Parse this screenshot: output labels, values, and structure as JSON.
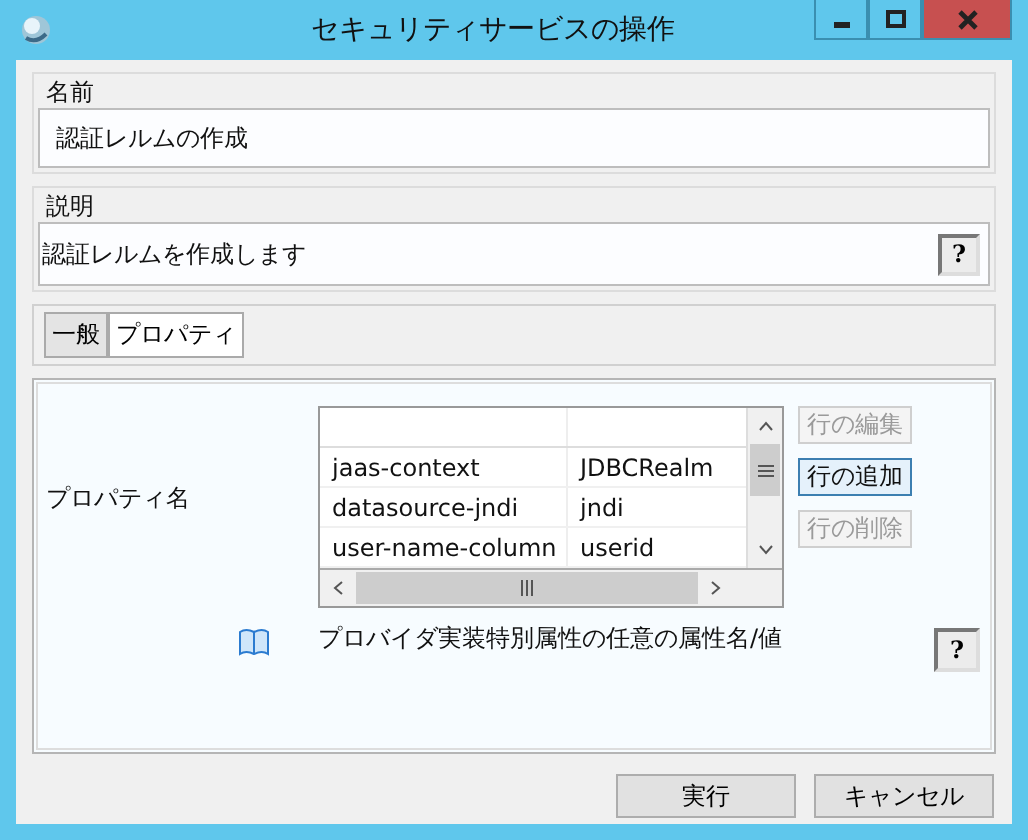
{
  "window": {
    "title": "セキュリティサービスの操作"
  },
  "name_group": {
    "label": "名前",
    "value": "認証レルムの作成"
  },
  "description_group": {
    "label": "説明",
    "value": "認証レルムを作成します",
    "help": "?"
  },
  "tabs": [
    {
      "label": "一般",
      "selected": false
    },
    {
      "label": "プロパティ",
      "selected": true
    }
  ],
  "properties": {
    "label": "プロパティ名",
    "rows": [
      {
        "name": "jaas-context",
        "value": "JDBCRealm"
      },
      {
        "name": "datasource-jndi",
        "value": "jndi"
      },
      {
        "name": "user-name-column",
        "value": "userid"
      }
    ],
    "row_buttons": [
      {
        "label": "行の編集",
        "disabled": true
      },
      {
        "label": "行の追加",
        "disabled": false
      },
      {
        "label": "行の削除",
        "disabled": true
      }
    ],
    "hint": "プロバイダ実装特別属性の任意の属性名/値",
    "help": "?"
  },
  "buttons": [
    "実行",
    "キャンセル"
  ]
}
